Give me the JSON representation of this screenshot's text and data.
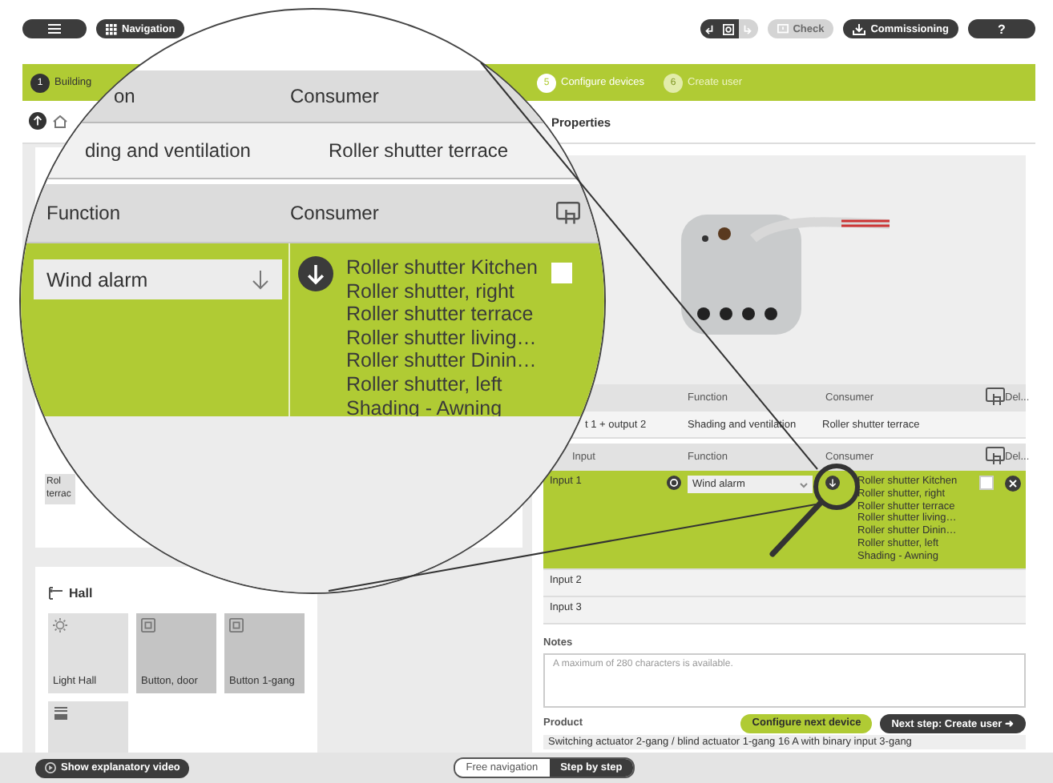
{
  "toolbar": {
    "navigation_button": "Navigation",
    "check_button": {
      "label": "Check",
      "disabled": true
    },
    "commissioning_button": "Commissioning",
    "help_button": "?"
  },
  "steps": [
    {
      "number": "1",
      "label": "Building",
      "completed": true,
      "selected": false
    },
    {
      "number": "5",
      "label": "Configure devices",
      "completed": false,
      "selected": true
    },
    {
      "number": "6",
      "label": "Create user",
      "completed": false,
      "selected": false
    }
  ],
  "properties_title": "Properties",
  "rooms": [
    {
      "tiles": [
        {
          "label": "Rol terrac",
          "kind": "blind"
        }
      ]
    },
    {
      "name": "Hall",
      "tiles": [
        {
          "label": "Light Hall",
          "kind": "light"
        },
        {
          "label": "Button, door",
          "kind": "button"
        },
        {
          "label": "Button 1-gang",
          "kind": "button"
        },
        {
          "kind": "blind"
        }
      ]
    }
  ],
  "output_table": {
    "columns": [
      "Function",
      "Consumer",
      "Del..."
    ],
    "rows": [
      {
        "input": "t 1 + output 2",
        "function": "Shading and ventilation",
        "consumer": "Roller shutter terrace"
      }
    ]
  },
  "input_table": {
    "columns": [
      "Input",
      "Function",
      "Consumer",
      "Del..."
    ],
    "rows": [
      {
        "input": "Input 1",
        "selected": true,
        "function": "Wind alarm",
        "checked": false,
        "consumers": [
          "Roller shutter Kitchen",
          "Roller shutter, right",
          "Roller shutter terrace",
          "Roller shutter living…",
          "Roller shutter Dinin…",
          "Roller shutter, left",
          "Shading - Awning"
        ]
      },
      {
        "input": "Input 2",
        "selected": false
      },
      {
        "input": "Input 3",
        "selected": false
      }
    ]
  },
  "notes": {
    "label": "Notes",
    "placeholder": "A maximum of 280 characters is available."
  },
  "product": {
    "label": "Product",
    "value": "Switching actuator 2-gang / blind actuator 1-gang 16 A with binary input 3-gang"
  },
  "actions": [
    {
      "label": "Configure next device",
      "kind": "secondary"
    },
    {
      "label": "Next step: Create user ➜",
      "kind": "primary"
    }
  ],
  "bottom_bar": {
    "video_button": "Show explanatory video",
    "modes": [
      {
        "label": "Free navigation",
        "selected": false
      },
      {
        "label": "Step by step",
        "selected": true
      }
    ]
  },
  "magnifier": {
    "upper_columns": [
      "on",
      "Consumer"
    ],
    "upper_row": [
      "ding and ventilation",
      "Roller shutter terrace"
    ],
    "columns": [
      "Function",
      "Consumer"
    ],
    "function": "Wind alarm",
    "checked": false,
    "consumers": [
      "Roller shutter Kitchen",
      "Roller shutter, right",
      "Roller shutter terrace",
      "Roller shutter living…",
      "Roller shutter Dinin…",
      "Roller shutter, left",
      "Shading - Awning"
    ]
  }
}
